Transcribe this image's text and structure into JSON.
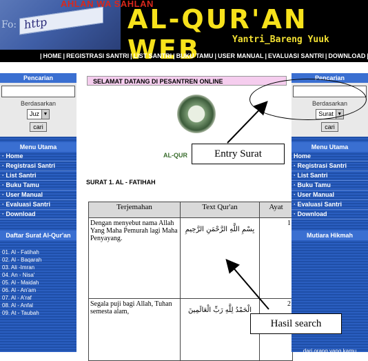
{
  "header": {
    "top_text": "AHLAN WA SAHLAN",
    "browser_text": "http",
    "fo_text": "Fo:",
    "title": "AL-QUR'AN WEB",
    "tagline": "Yantri_Bareng Yuuk",
    "nav": [
      "HOME",
      "REGISTRASI SANTRI",
      "LIST SANTRI",
      "BUKU TAMU",
      "USER MANUAL",
      "EVALUASI SANTRI",
      "DOWNLOAD"
    ]
  },
  "left_sidebar": {
    "search_heading": "Pencarian",
    "search_value": "",
    "by_label": "Berdasarkan",
    "select_value": "Juz",
    "search_button": "cari",
    "menu_heading": "Menu Utama",
    "menu": [
      "Home",
      "Registrasi Santri",
      "List Santri",
      "Buku Tamu",
      "User Manual",
      "Evaluasi Santri",
      "Download"
    ],
    "surah_heading": "Daftar Surat Al-Qur'an",
    "surahs": [
      "01. Al - Fatihah",
      "02. Al - Baqarah",
      "03. Ali -Imran",
      "04. An - Nisa'",
      "05. Al - Maidah",
      "06. Al - An'am",
      "07. Al - A'raf",
      "08. Al - Anfal",
      "09. At - Taubah"
    ]
  },
  "content": {
    "welcome": "SELAMAT DATANG DI PESANTREN ONLINE",
    "logo_caption": "AL-QUR",
    "surah_title": "SURAT 1. AL - FATIHAH",
    "table_headers": [
      "Terjemahan",
      "Text Qur'an",
      "Ayat"
    ],
    "rows": [
      {
        "translation": "Dengan menyebut nama Allah Yang Maha Pemurah lagi Maha Penyayang.",
        "arabic": "بِسْمِ اللَّهِ الرَّحْمَنِ الرَّحِيمِ",
        "ayat": "1"
      },
      {
        "translation": "Segala puji bagi Allah, Tuhan semesta alam,",
        "arabic": "الْحَمْدُ لِلَّهِ رَبِّ الْعَالَمِينَ",
        "ayat": "2"
      }
    ]
  },
  "right_sidebar": {
    "search_heading": "Pencarian",
    "search_value": "",
    "by_label": "Berdasarkan",
    "select_value": "Surat",
    "search_button": "cari",
    "menu_heading": "Menu Utama",
    "menu": [
      "Home",
      "Registrasi Santri",
      "List Santri",
      "Buku Tamu",
      "User Manual",
      "Evaluasi Santri",
      "Download"
    ],
    "hikmah_heading": "Mutiara Hikmah",
    "hikmah_text": "dari orang yang kamu"
  },
  "annotations": {
    "entry": "Entry Surat",
    "result": "Hasil search"
  }
}
